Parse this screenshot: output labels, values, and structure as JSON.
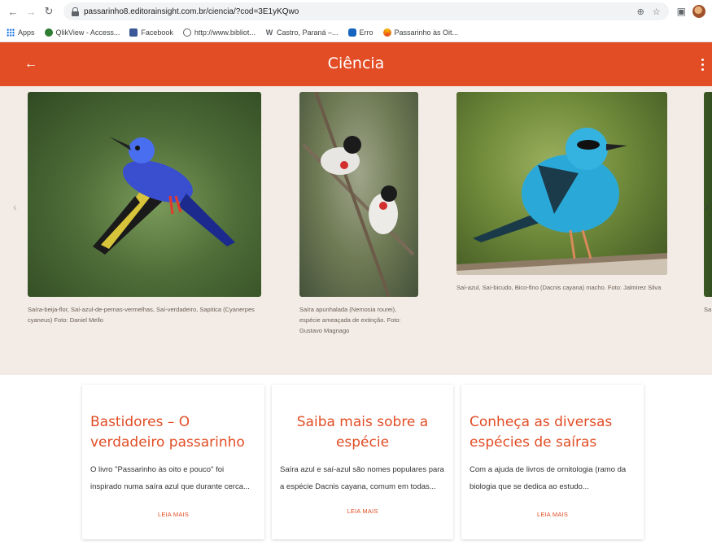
{
  "browser": {
    "url": "passarinho8.editorainsight.com.br/ciencia/?cod=3E1yKQwo",
    "bookmarks": [
      {
        "label": "Apps",
        "icon": "apps-grid-icon"
      },
      {
        "label": "QlikView - Access...",
        "icon": "qlikview-icon"
      },
      {
        "label": "Facebook",
        "icon": "facebook-icon"
      },
      {
        "label": "http://www.bibliot...",
        "icon": "globe-icon"
      },
      {
        "label": "Castro, Paraná –...",
        "icon": "wikipedia-icon"
      },
      {
        "label": "Erro",
        "icon": "doc-icon"
      },
      {
        "label": "Passarinho às Oit...",
        "icon": "swirl-icon"
      }
    ]
  },
  "header": {
    "title": "Ciência",
    "back_icon": "arrow-left-icon",
    "menu_icon": "kebab-menu-icon",
    "color": "#e24d25"
  },
  "gallery": {
    "slides": [
      {
        "caption": "Saíra-beija-flor, Saí-azul-de-pernas-vermelhas, Saí-verdadeiro, Sapitica (Cyanerpes cyaneus) Foto: Daniel Mello"
      },
      {
        "caption": "Saíra apunhalada (Nemosia rourei), espécie ameaçada de extinção. Foto: Gustavo Magnago"
      },
      {
        "caption": "Saí-azul, Saí-bicudo, Bico-fino (Dacnis cayana) macho. Foto: Jalmirez Silva"
      },
      {
        "caption": "Sa"
      }
    ]
  },
  "cards": [
    {
      "title": "Bastidores – O verdadeiro passarinho",
      "text": "O livro \"Passarinho às oito e pouco\" foi inspirado numa saíra azul que durante cerca...",
      "more": "LEIA MAIS"
    },
    {
      "title": "Saiba mais sobre a espécie",
      "text": "Saíra azul e saí-azul são nomes populares para a espécie Dacnis cayana, comum em todas...",
      "more": "LEIA MAIS"
    },
    {
      "title": "Conheça as diversas espécies de saíras",
      "text": "Com a ajuda de livros de ornitologia (ramo da biologia que se dedica ao estudo...",
      "more": "LEIA MAIS"
    }
  ]
}
